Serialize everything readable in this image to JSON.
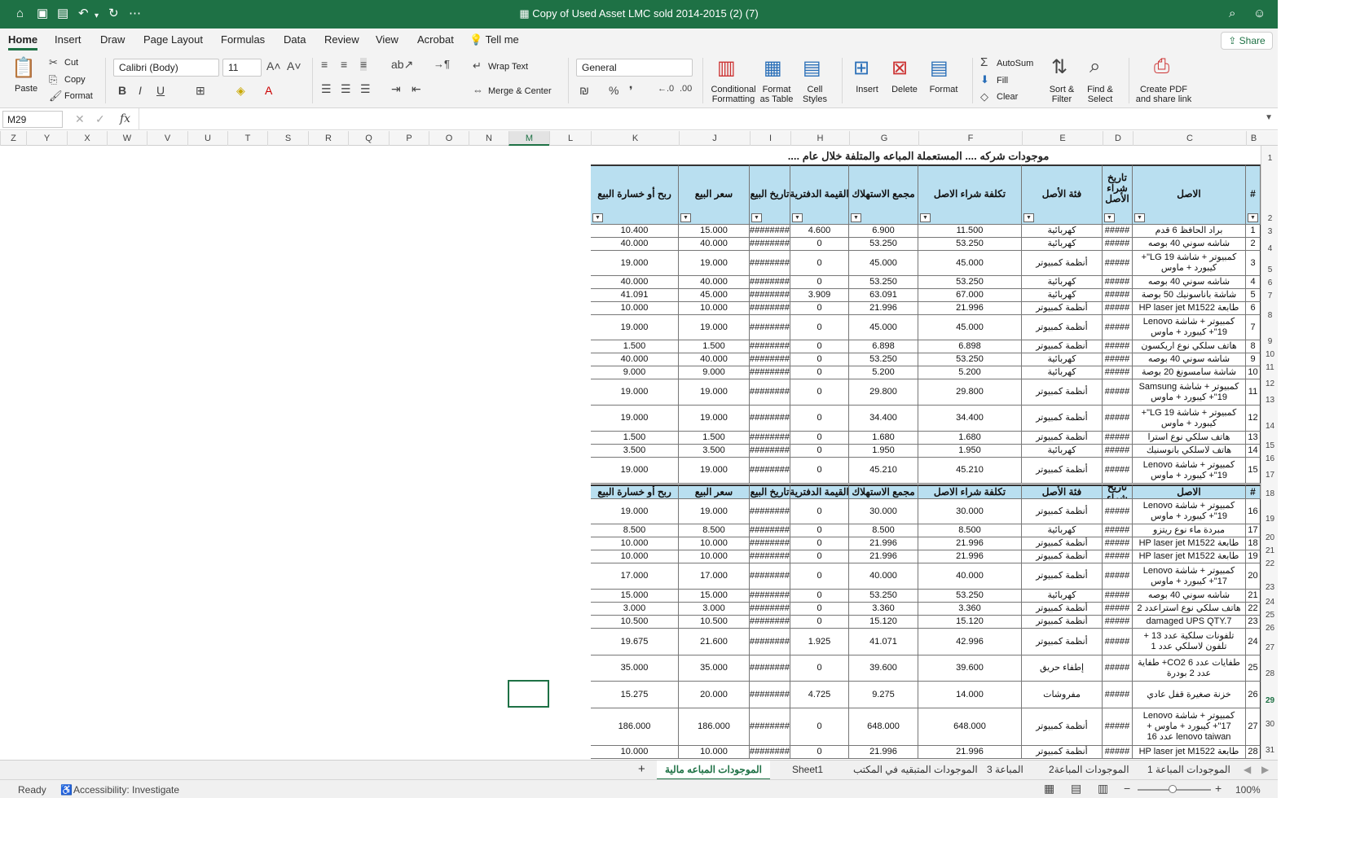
{
  "window": {
    "title": "Copy of Used Asset LMC sold 2014-2015  (2) (7)"
  },
  "ribbon_tabs": [
    "Home",
    "Insert",
    "Draw",
    "Page Layout",
    "Formulas",
    "Data",
    "Review",
    "View",
    "Acrobat",
    "Tell me"
  ],
  "share_label": "Share",
  "clipboard": {
    "paste": "Paste",
    "cut": "Cut",
    "copy": "Copy",
    "format": "Format"
  },
  "font": {
    "name": "Calibri (Body)",
    "size": "11"
  },
  "alignment": {
    "wrap": "Wrap Text",
    "merge": "Merge & Center"
  },
  "number": {
    "format": "General"
  },
  "styles": {
    "conditional": "Conditional Formatting",
    "table": "Format as Table",
    "cell": "Cell Styles"
  },
  "cells_group": {
    "insert": "Insert",
    "delete": "Delete",
    "format": "Format"
  },
  "editing": {
    "autosum": "AutoSum",
    "fill": "Fill",
    "clear": "Clear",
    "sort": "Sort & Filter",
    "find": "Find & Select"
  },
  "pdf": {
    "label": "Create PDF and share link"
  },
  "formula_bar": {
    "name_box": "M29",
    "fx": "fx",
    "value": ""
  },
  "columns": [
    "Z",
    "Y",
    "X",
    "W",
    "V",
    "U",
    "T",
    "S",
    "R",
    "Q",
    "P",
    "O",
    "N",
    "M",
    "L",
    "K",
    "J",
    "I",
    "H",
    "G",
    "F",
    "E",
    "D",
    "C",
    "B"
  ],
  "row_numbers": [
    "1",
    "2",
    "3",
    "4",
    "5",
    "6",
    "7",
    "8",
    "9",
    "10",
    "11",
    "12",
    "13",
    "14",
    "15",
    "16",
    "17",
    "18",
    "19",
    "20",
    "21",
    "22",
    "23",
    "24",
    "25",
    "26",
    "27",
    "28",
    "29",
    "30",
    "31"
  ],
  "sheet": {
    "title": "موجودات شركه .... المستعملة المباعه والمتلفة خلال عام ....",
    "headers": [
      "#",
      "الاصل",
      "تاريخ شراء الأصل",
      "فئة الأصل",
      "تكلفة شراء الاصل",
      "مجمع الاستهلاك",
      "القيمة الدفترية",
      "تاريخ البيع",
      "سعر البيع",
      "ربح أو خسارة البيع"
    ],
    "rows": [
      [
        "1",
        "براد الحافظ 6 قدم",
        "#####",
        "كهربائية",
        "11.500",
        "6.900",
        "4.600",
        "########",
        "15.000",
        "10.400"
      ],
      [
        "2",
        "شاشه سوني 40 بوصه",
        "#####",
        "كهربائية",
        "53.250",
        "53.250",
        "0",
        "########",
        "40.000",
        "40.000"
      ],
      [
        "3",
        "كمبيوتر + شاشة LG 19\"+ كيبورد + ماوس",
        "#####",
        "أنظمة كمبيوتر",
        "45.000",
        "45.000",
        "0",
        "########",
        "19.000",
        "19.000"
      ],
      [
        "4",
        "شاشه سوني 40 بوصه",
        "#####",
        "كهربائية",
        "53.250",
        "53.250",
        "0",
        "########",
        "40.000",
        "40.000"
      ],
      [
        "5",
        "شاشة باناسونيك 50 بوصة",
        "#####",
        "كهربائية",
        "67.000",
        "63.091",
        "3.909",
        "########",
        "45.000",
        "41.091"
      ],
      [
        "6",
        "طابعة HP laser jet M1522",
        "#####",
        "أنظمة كمبيوتر",
        "21.996",
        "21.996",
        "0",
        "########",
        "10.000",
        "10.000"
      ],
      [
        "7",
        "كمبيوتر + شاشة Lenovo 19\"+ كيبورد + ماوس",
        "#####",
        "أنظمة كمبيوتر",
        "45.000",
        "45.000",
        "0",
        "########",
        "19.000",
        "19.000"
      ],
      [
        "8",
        "هاتف سلكي نوع اريكسون",
        "#####",
        "أنظمة كمبيوتر",
        "6.898",
        "6.898",
        "0",
        "########",
        "1.500",
        "1.500"
      ],
      [
        "9",
        "شاشه سوني 40 بوصه",
        "#####",
        "كهربائية",
        "53.250",
        "53.250",
        "0",
        "########",
        "40.000",
        "40.000"
      ],
      [
        "10",
        "شاشة سامسونغ 20 بوصة",
        "#####",
        "كهربائية",
        "5.200",
        "5.200",
        "0",
        "########",
        "9.000",
        "9.000"
      ],
      [
        "11",
        "كمبيوتر + شاشة Samsung 19\"+ كيبورد + ماوس",
        "#####",
        "أنظمة كمبيوتر",
        "29.800",
        "29.800",
        "0",
        "########",
        "19.000",
        "19.000"
      ],
      [
        "12",
        "كمبيوتر + شاشة LG 19\"+ كيبورد + ماوس",
        "#####",
        "أنظمة كمبيوتر",
        "34.400",
        "34.400",
        "0",
        "########",
        "19.000",
        "19.000"
      ],
      [
        "13",
        "هاتف سلكي نوع استرا",
        "#####",
        "أنظمة كمبيوتر",
        "1.680",
        "1.680",
        "0",
        "########",
        "1.500",
        "1.500"
      ],
      [
        "14",
        "هاتف لاسلكي بانوسنيك",
        "#####",
        "كهربائية",
        "1.950",
        "1.950",
        "0",
        "########",
        "3.500",
        "3.500"
      ],
      [
        "15",
        "كمبيوتر + شاشة Lenovo 19\"+ كيبورد + ماوس",
        "#####",
        "أنظمة كمبيوتر",
        "45.210",
        "45.210",
        "0",
        "########",
        "19.000",
        "19.000"
      ]
    ],
    "headers2": [
      "#",
      "الاصل",
      "تاريخ شراء",
      "فئة الأصل",
      "تكلفة شراء الاصل",
      "مجمع الاستهلاك",
      "القيمة الدفترية",
      "تاريخ البيع",
      "سعر البيع",
      "ربح أو خسارة البيع"
    ],
    "rows2": [
      [
        "16",
        "كمبيوتر + شاشة Lenovo 19\"+ كيبورد + ماوس",
        "#####",
        "أنظمة كمبيوتر",
        "30.000",
        "30.000",
        "0",
        "########",
        "19.000",
        "19.000"
      ],
      [
        "17",
        "مبردة ماء نوع ريتزو",
        "#####",
        "كهربائية",
        "8.500",
        "8.500",
        "0",
        "########",
        "8.500",
        "8.500"
      ],
      [
        "18",
        "طابعة HP laser jet M1522",
        "#####",
        "أنظمة كمبيوتر",
        "21.996",
        "21.996",
        "0",
        "########",
        "10.000",
        "10.000"
      ],
      [
        "19",
        "طابعة HP laser jet M1522",
        "#####",
        "أنظمة كمبيوتر",
        "21.996",
        "21.996",
        "0",
        "########",
        "10.000",
        "10.000"
      ],
      [
        "20",
        "كمبيوتر + شاشة Lenovo 17\"+ كيبورد + ماوس",
        "#####",
        "أنظمة كمبيوتر",
        "40.000",
        "40.000",
        "0",
        "########",
        "17.000",
        "17.000"
      ],
      [
        "21",
        "شاشه سوني 40 بوصه",
        "#####",
        "كهربائية",
        "53.250",
        "53.250",
        "0",
        "########",
        "15.000",
        "15.000"
      ],
      [
        "22",
        "هاتف سلكي نوع استراعدد 2",
        "#####",
        "أنظمة كمبيوتر",
        "3.360",
        "3.360",
        "0",
        "########",
        "3.000",
        "3.000"
      ],
      [
        "23",
        "damaged UPS QTY.7",
        "#####",
        "أنظمة كمبيوتر",
        "15.120",
        "15.120",
        "0",
        "########",
        "10.500",
        "10.500"
      ],
      [
        "24",
        "تلفونات سلكية عدد 13 + تلفون لاسلكي عدد 1",
        "#####",
        "أنظمة كمبيوتر",
        "42.996",
        "41.071",
        "1.925",
        "########",
        "21.600",
        "19.675"
      ],
      [
        "25",
        "طفايات عدد 6 CO2+ طفاية عدد 2 بودرة",
        "#####",
        "إطفاء حريق",
        "39.600",
        "39.600",
        "0",
        "########",
        "35.000",
        "35.000"
      ],
      [
        "26",
        "خزنة صغيرة قفل عادي",
        "#####",
        "مفروشات",
        "14.000",
        "9.275",
        "4.725",
        "########",
        "20.000",
        "15.275"
      ],
      [
        "27",
        "كمبيوتر + شاشة Lenovo 17\"+ كيبورد + ماوس + lenovo taiwan عدد 16",
        "#####",
        "أنظمة كمبيوتر",
        "648.000",
        "648.000",
        "0",
        "########",
        "186.000",
        "186.000"
      ],
      [
        "28",
        "طابعة HP laser jet M1522",
        "#####",
        "أنظمة كمبيوتر",
        "21.996",
        "21.996",
        "0",
        "########",
        "10.000",
        "10.000"
      ]
    ]
  },
  "sheet_tabs": [
    "الموجودات المباعة 1",
    "الموجودات المباعة2",
    "المباعة 3",
    "الموجودات المتبقيه في المكتب",
    "Sheet1",
    "الموجودات المباعه  مالية"
  ],
  "status": {
    "ready": "Ready",
    "accessibility": "Accessibility: Investigate",
    "zoom": "100%"
  }
}
